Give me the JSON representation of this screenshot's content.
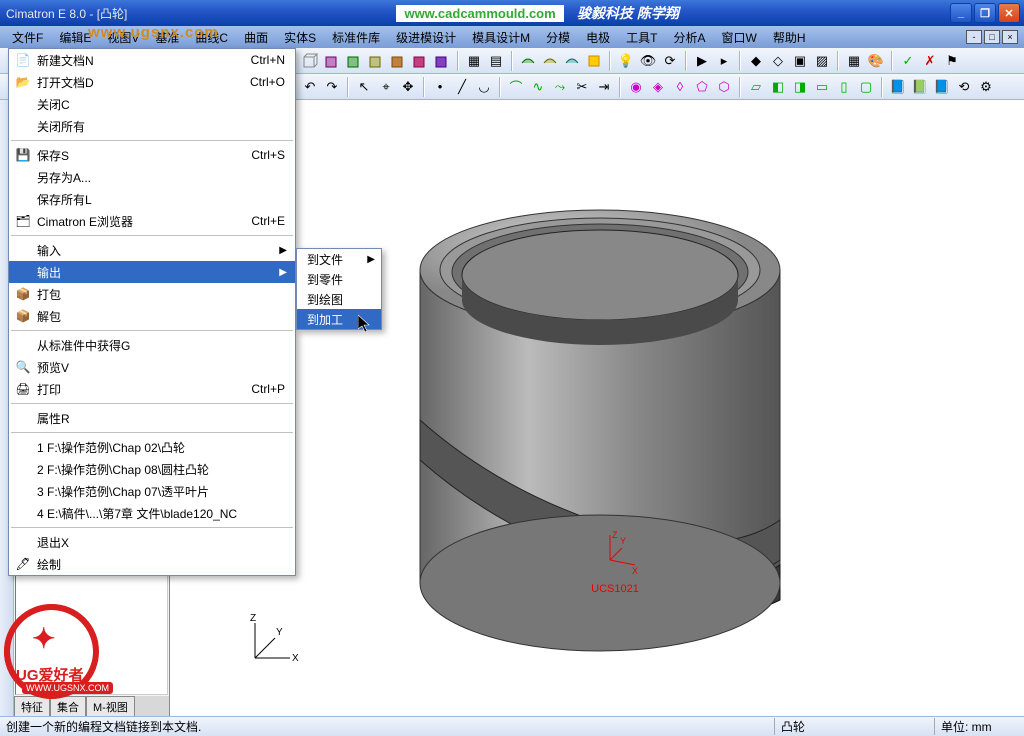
{
  "title_app": "Cimatron E 8.0 - [凸轮]",
  "overlay_url": "www.ugsnx.com",
  "header_url": "www.cadcammould.com",
  "header_company": "骏毅科技  陈学翔",
  "menubar": [
    "文件F",
    "编辑E",
    "视图V",
    "基准",
    "曲线C",
    "曲面",
    "实体S",
    "标准件库",
    "级进模设计",
    "模具设计M",
    "分模",
    "电极",
    "工具T",
    "分析A",
    "窗口W",
    "帮助H"
  ],
  "file_menu": {
    "items": [
      {
        "icon": "📄",
        "label": "新建文档N",
        "shortcut": "Ctrl+N"
      },
      {
        "icon": "📂",
        "label": "打开文档D",
        "shortcut": "Ctrl+O"
      },
      {
        "icon": "",
        "label": "关闭C",
        "shortcut": ""
      },
      {
        "icon": "",
        "label": "关闭所有",
        "shortcut": ""
      },
      {
        "sep": true
      },
      {
        "icon": "💾",
        "label": "保存S",
        "shortcut": "Ctrl+S"
      },
      {
        "icon": "",
        "label": "另存为A...",
        "shortcut": ""
      },
      {
        "icon": "",
        "label": "保存所有L",
        "shortcut": ""
      },
      {
        "icon": "🗂",
        "label": "Cimatron E浏览器",
        "shortcut": "Ctrl+E"
      },
      {
        "sep": true
      },
      {
        "icon": "",
        "label": "输入",
        "shortcut": "",
        "arrow": true
      },
      {
        "icon": "",
        "label": "输出",
        "shortcut": "",
        "arrow": true,
        "hl": true
      },
      {
        "icon": "📦",
        "label": "打包",
        "shortcut": ""
      },
      {
        "icon": "📦",
        "label": "解包",
        "shortcut": ""
      },
      {
        "sep": true
      },
      {
        "icon": "",
        "label": "从标准件中获得G",
        "shortcut": ""
      },
      {
        "icon": "🔍",
        "label": "预览V",
        "shortcut": ""
      },
      {
        "icon": "🖨",
        "label": "打印",
        "shortcut": "Ctrl+P"
      },
      {
        "sep": true
      },
      {
        "icon": "",
        "label": "属性R",
        "shortcut": ""
      },
      {
        "sep": true
      },
      {
        "icon": "",
        "label": "1 F:\\操作范例\\Chap 02\\凸轮",
        "shortcut": ""
      },
      {
        "icon": "",
        "label": "2 F:\\操作范例\\Chap 08\\圆柱凸轮",
        "shortcut": ""
      },
      {
        "icon": "",
        "label": "3 F:\\操作范例\\Chap 07\\透平叶片",
        "shortcut": ""
      },
      {
        "icon": "",
        "label": "4 E:\\稿件\\...\\第7章 文件\\blade120_NC",
        "shortcut": ""
      },
      {
        "sep": true
      },
      {
        "icon": "",
        "label": "退出X",
        "shortcut": ""
      },
      {
        "icon": "🖊",
        "label": "绘制",
        "shortcut": ""
      }
    ]
  },
  "submenu": {
    "items": [
      {
        "label": "到文件",
        "arrow": true
      },
      {
        "label": "到零件"
      },
      {
        "label": "到绘图"
      },
      {
        "label": "到加工",
        "hl": true
      }
    ]
  },
  "tabs": [
    "特征",
    "集合",
    "M-视图"
  ],
  "axis": {
    "x": "X",
    "y": "Y",
    "z": "Z"
  },
  "ucs": {
    "x": "X",
    "y": "Y",
    "z": "Z",
    "label": "UCS1021"
  },
  "status": {
    "left": "创建一个新的编程文档链接到本文档.",
    "r1": "凸轮",
    "r2": "单位: mm"
  },
  "watermark": {
    "title": "UG爱好者",
    "sub": "WWW.UGSNX.COM"
  }
}
